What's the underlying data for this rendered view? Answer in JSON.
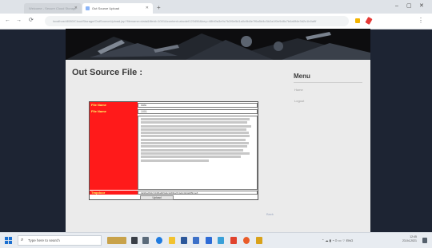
{
  "browser": {
    "tabs": [
      {
        "label": "Welcome - Secure Cloud Storage",
        "active": false
      },
      {
        "label": "Out Source Upload",
        "active": true
      }
    ],
    "url": "localhost:8080/CloudStorage/OutSourceUpload.jsp?filename=data&fileid=1001&content=abcdef123456&key=48fd0a3e9c7b2f6e5d1a0c9b8e7f6a5d4c3b2a1f0e9d8c7b6a5f4e3d2c1b0a9f"
  },
  "page": {
    "title": "Out Source File :",
    "sidebar": {
      "title": "Menu",
      "items": [
        "Home",
        "Logout"
      ]
    },
    "form": {
      "rows": [
        {
          "label": "File Name",
          "value": "data"
        },
        {
          "label": "File Name",
          "value": "1001"
        }
      ],
      "mac_label": "Trapdoor",
      "mac_value": "3a9f1e8b2c7d4f6a0b5e9c1d8f2a7b3e6c0d4a9f5b1e8",
      "submit_label": "Upload"
    },
    "back_link": "Back"
  },
  "taskbar": {
    "search_placeholder": "Type here to search",
    "time": "12:45",
    "date": "23-04-2021"
  },
  "colors": {
    "label_cell": "#ff1a1a",
    "label_text": "#ffff66",
    "page_bg": "#1d2433"
  }
}
